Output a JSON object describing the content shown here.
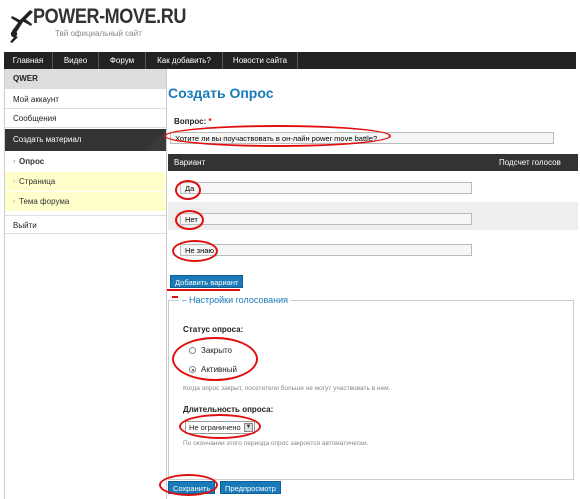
{
  "logo": {
    "title": "POWER-MOVE.RU",
    "subtitle": "Твй официальный сайт"
  },
  "nav": [
    "Главная",
    "Видео",
    "Форум",
    "Как добавить?",
    "Новости сайта"
  ],
  "sidebar": {
    "user": "QWER",
    "links": [
      "Мой аккаунт",
      "Сообщения"
    ],
    "section": "Создать материал",
    "subitems": [
      "Опрос",
      "Страница",
      "Тема форума"
    ],
    "logout": "Выйти"
  },
  "form": {
    "title": "Создать Опрос",
    "question_label": "Вопрос:",
    "required_mark": "*",
    "question_value": "Хотите ли вы поучаствовать в он-лайн power move battle?",
    "col_variant": "Вариант",
    "col_votes": "Подсчет голосов",
    "choices": [
      "Да",
      "Нет",
      "Не знаю"
    ],
    "add_choice": "Добавить вариант",
    "settings_legend": "Настройки голосования",
    "status_label": "Статус опроса:",
    "status_options": [
      "Закрыто",
      "Активный"
    ],
    "status_selected": "Активный",
    "status_help": "Когда опрос закрыт, посетители больше не могут участвовать в нем.",
    "duration_label": "Длительность опроса:",
    "duration_value": "Не ограничено",
    "duration_help": "По окончании этого периода опрос закроется автоматически.",
    "save": "Сохранить",
    "preview": "Предпросмотр"
  },
  "colors": {
    "accent": "#1a7ab8",
    "highlight": "#e01010",
    "nav": "#222222"
  }
}
